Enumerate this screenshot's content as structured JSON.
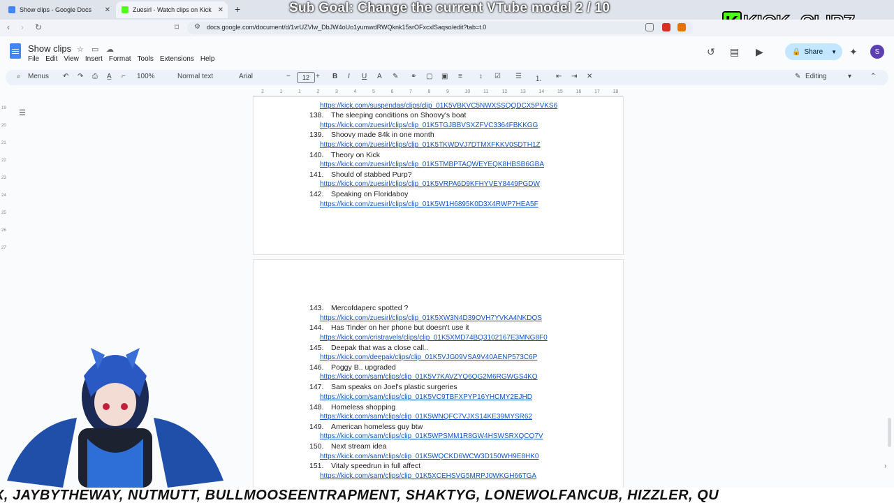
{
  "tabs": [
    {
      "title": "Show clips - Google Docs",
      "active": false,
      "color": "#4285f4"
    },
    {
      "title": "Zuesirl - Watch clips on Kick",
      "active": true,
      "color": "#53fc18"
    }
  ],
  "overlay": {
    "sub_goal": "Sub Goal: Change the current VTube model  2 / 10",
    "kick_logo": "KICK_CLIPZ",
    "kick_k": "K",
    "ticker": "X, JAYBYTHEWAY, NUTMUTT, BULLMOOSEENTRAPMENT, SHAKTYG, LONEWOLFANCUB, HIZZLER, QU"
  },
  "browser": {
    "url": "docs.google.com/document/d/1vrUZVlw_DbJW4oUo1yumwdRWQknk15srOFxcxlSaqso/edit?tab=t.0"
  },
  "doc": {
    "title": "Show clips",
    "menus": [
      "File",
      "Edit",
      "View",
      "Insert",
      "Format",
      "Tools",
      "Extensions",
      "Help"
    ],
    "share_label": "Share",
    "avatar_letter": "S",
    "toolbar": {
      "search": "Menus",
      "zoom": "100%",
      "style": "Normal text",
      "font": "Arial",
      "size": "12",
      "mode": "Editing"
    }
  },
  "ruler": [
    "2",
    "1",
    "1",
    "2",
    "3",
    "4",
    "5",
    "6",
    "7",
    "8",
    "9",
    "10",
    "11",
    "12",
    "13",
    "14",
    "15",
    "16",
    "17",
    "18"
  ],
  "vruler": [
    "19",
    "20",
    "21",
    "22",
    "23",
    "24",
    "25",
    "26",
    "27"
  ],
  "page1": {
    "top_link": "https://kick.com/suspendas/clips/clip_01K5VBKVC5NWXSSQQDCX5PVKS6",
    "items": [
      {
        "num": "138.",
        "text": "The sleeping conditions on Shoovy's boat",
        "link": "https://kick.com/zuesirl/clips/clip_01K5TGJBBVSXZFVC3364FBKKGG"
      },
      {
        "num": "139.",
        "text": "Shoovy made 84k in one month",
        "link": "https://kick.com/zuesirl/clips/clip_01K5TKWDVJ7DTMXFKKV0SDTH1Z"
      },
      {
        "num": "140.",
        "text": "Theory on Kick",
        "link": "https://kick.com/zuesirl/clips/clip_01K5TMBPTAQWEYEQK8HBSB6GBA"
      },
      {
        "num": "141.",
        "text": "Should of stabbed Purp?",
        "link": "https://kick.com/zuesirl/clips/clip_01K5VRPA6D9KFHYVEY8449PGDW"
      },
      {
        "num": "142.",
        "text": "Speaking on Floridaboy",
        "link": "https://kick.com/zuesirl/clips/clip_01K5W1H6895K0D3X4RWP7HEA5F"
      }
    ]
  },
  "page2": {
    "items": [
      {
        "num": "143.",
        "text": "Mercofdaperc spotted ?",
        "link": "https://kick.com/zuesirl/clips/clip_01K5XW3N4D39QVH7YVKA4NKDQS"
      },
      {
        "num": "144.",
        "text": "Has Tinder on her phone but doesn't use it",
        "link": "https://kick.com/cristravels/clips/clip_01K5XMD74BQ3102167E3MNG8F0"
      },
      {
        "num": "145.",
        "text": "Deepak that was a close call..",
        "link": "https://kick.com/deepak/clips/clip_01K5VJG09VSA9V40AENP573C6P"
      },
      {
        "num": "146.",
        "text": "Poggy B.. upgraded",
        "link": "https://kick.com/sam/clips/clip_01K5V7KAVZYQ6QG2M6RGWGS4KQ"
      },
      {
        "num": "147.",
        "text": "Sam speaks on Joel's plastic surgeries",
        "link": "https://kick.com/sam/clips/clip_01K5VC9TBFXPYP16YHCMY2EJHD"
      },
      {
        "num": "148.",
        "text": "Homeless shopping",
        "link": "https://kick.com/sam/clips/clip_01K5WNQFC7VJXS14KE39MYSR62"
      },
      {
        "num": "149.",
        "text": "American homeless guy btw",
        "link": "https://kick.com/sam/clips/clip_01K5WPSMM1R8GW4HSWSRXQCQ7V"
      },
      {
        "num": "150.",
        "text": "Next stream idea",
        "link": "https://kick.com/sam/clips/clip_01K5WQCKD6WCW3D150WH9E8HK0"
      },
      {
        "num": "151.",
        "text": "Vitaly speedrun in full affect",
        "link": "https://kick.com/sam/clips/clip_01K5XCEHSVG5MRPJ0WKGH66TGA"
      }
    ]
  }
}
